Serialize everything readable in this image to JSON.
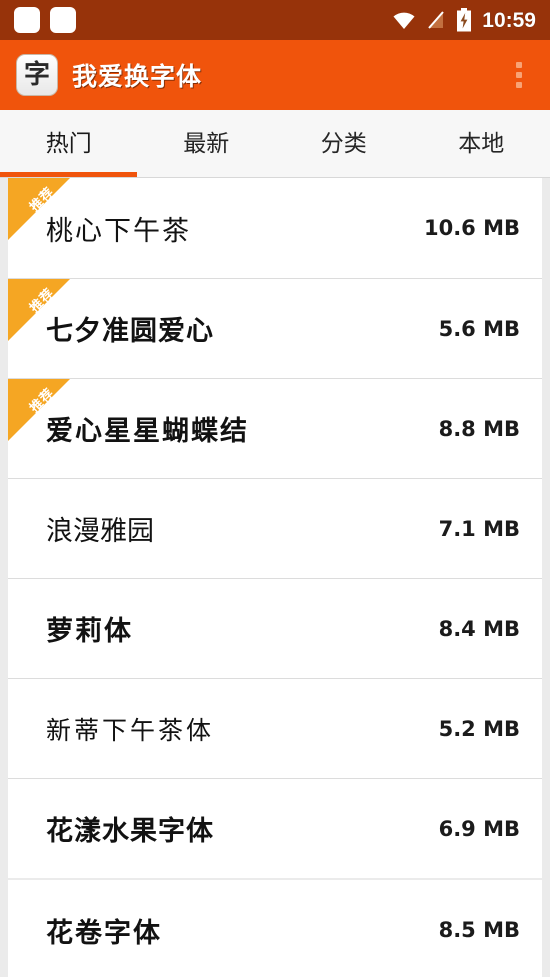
{
  "statusbar": {
    "time": "10:59",
    "left_icons": [
      "notification-placeholder",
      "notification-placeholder"
    ],
    "right_icons": [
      "wifi-icon",
      "signal-off-icon",
      "battery-charging-icon"
    ],
    "background_color": "#97330a"
  },
  "appbar": {
    "icon_glyph": "字",
    "title": "我爱换字体",
    "overflow_label": "more-options",
    "background_color": "#f0540c"
  },
  "tabs": {
    "items": [
      {
        "label": "热门",
        "active": true
      },
      {
        "label": "最新",
        "active": false
      },
      {
        "label": "分类",
        "active": false
      },
      {
        "label": "本地",
        "active": false
      }
    ],
    "indicator_color": "#f0540c"
  },
  "list": {
    "ribbon_label": "推荐",
    "ribbon_color": "#f5a623",
    "items": [
      {
        "name": "桃心下午茶",
        "size": "10.6 MB",
        "recommended": true,
        "style": "style-hand"
      },
      {
        "name": "七夕准圆爱心",
        "size": "5.6 MB",
        "recommended": true,
        "style": "style-round"
      },
      {
        "name": "爱心星星蝴蝶结",
        "size": "8.8 MB",
        "recommended": true,
        "style": "style-bold"
      },
      {
        "name": "浪漫雅园",
        "size": "7.1 MB",
        "recommended": false,
        "style": "style-plain"
      },
      {
        "name": "萝莉体",
        "size": "8.4 MB",
        "recommended": false,
        "style": "style-bold"
      },
      {
        "name": "新蒂下午茶体",
        "size": "5.2 MB",
        "recommended": false,
        "style": "style-thin"
      },
      {
        "name": "花漾水果字体",
        "size": "6.9 MB",
        "recommended": false,
        "style": "style-round"
      },
      {
        "name": "花卷字体",
        "size": "8.5 MB",
        "recommended": false,
        "style": "style-bold"
      }
    ]
  }
}
